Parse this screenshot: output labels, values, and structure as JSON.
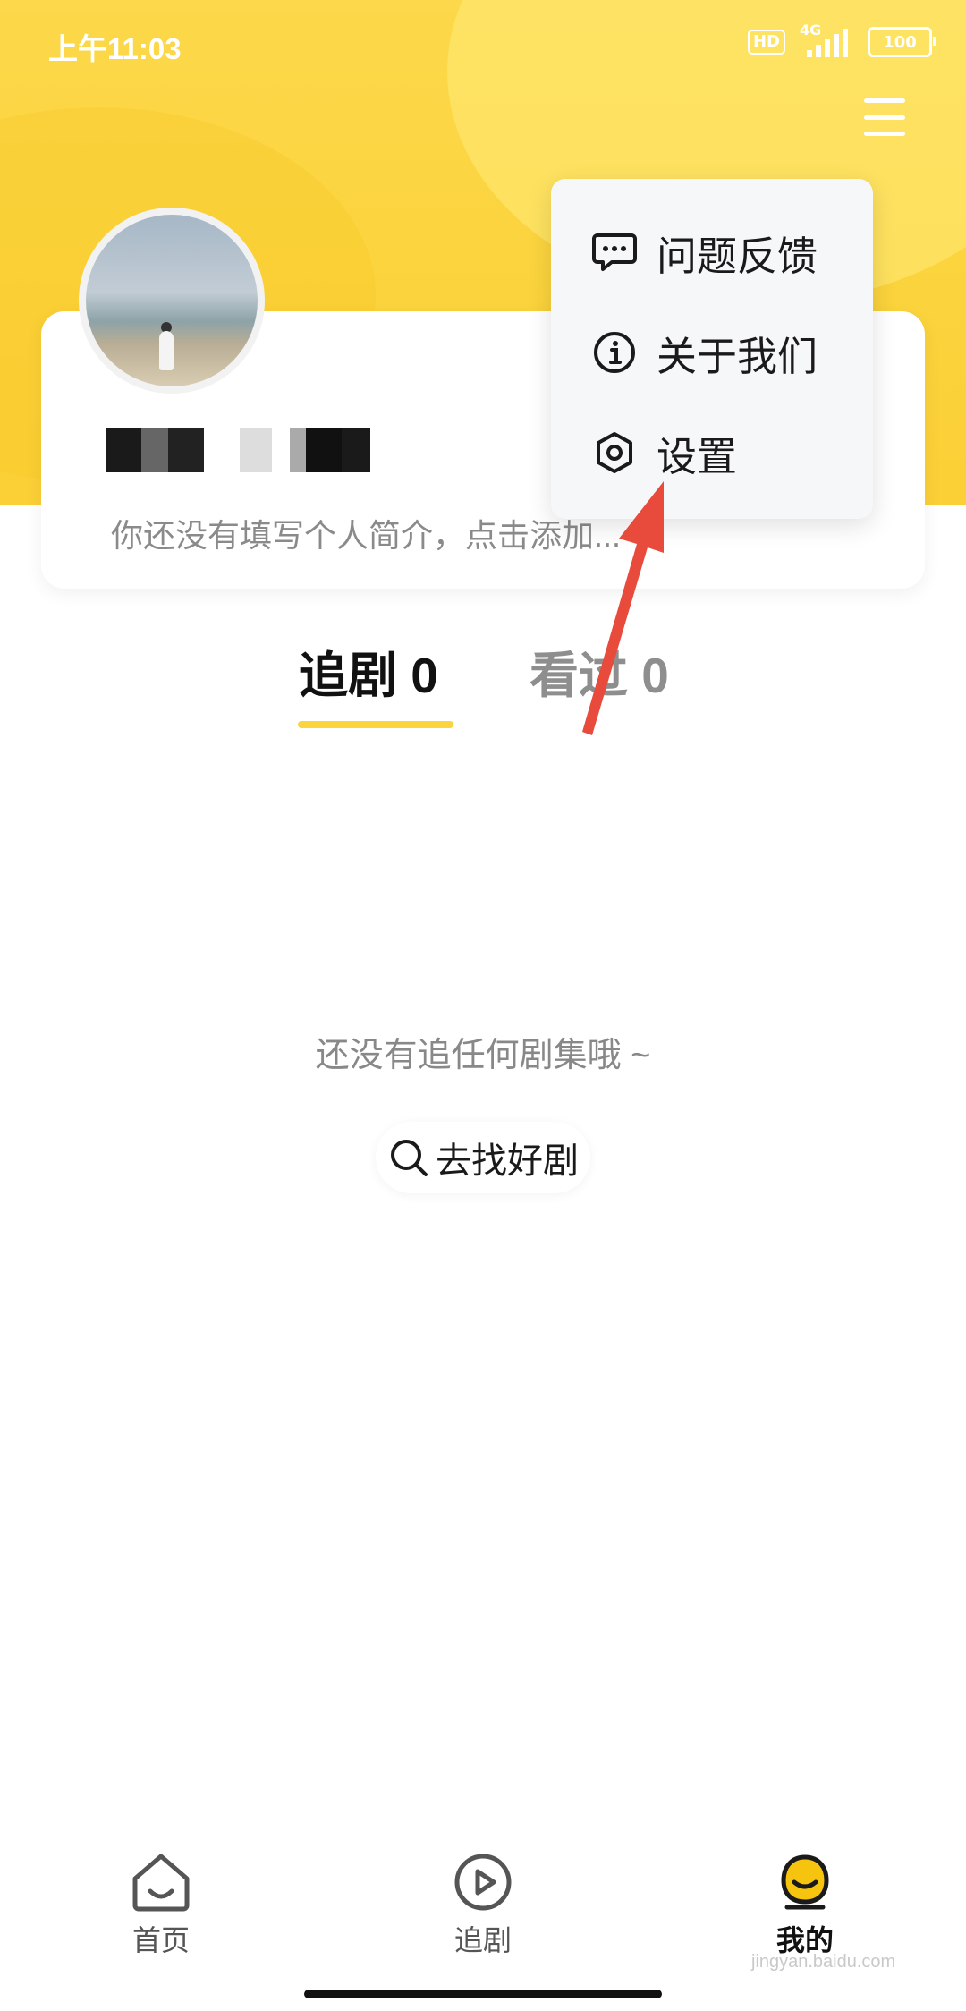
{
  "status_bar": {
    "time": "上午11:03",
    "hd": "HD",
    "network": "4G",
    "battery": "100"
  },
  "profile": {
    "bio": "你还没有填写个人简介，点击添加..."
  },
  "dropdown": {
    "items": [
      {
        "label": "问题反馈",
        "icon": "chat-bubble-icon"
      },
      {
        "label": "关于我们",
        "icon": "info-icon"
      },
      {
        "label": "设置",
        "icon": "settings-icon"
      }
    ]
  },
  "tabs": [
    {
      "label": "追剧 0",
      "active": true
    },
    {
      "label": "看过 0",
      "active": false
    }
  ],
  "empty_state": {
    "message": "还没有追任何剧集哦 ~",
    "button": "去找好剧"
  },
  "bottom_nav": [
    {
      "label": "首页",
      "icon": "home-icon"
    },
    {
      "label": "追剧",
      "icon": "play-icon"
    },
    {
      "label": "我的",
      "icon": "profile-icon",
      "active": true
    }
  ],
  "watermark": "jingyan.baidu.com",
  "colors": {
    "accent": "#fbd43e",
    "arrow": "#e84a3c"
  }
}
